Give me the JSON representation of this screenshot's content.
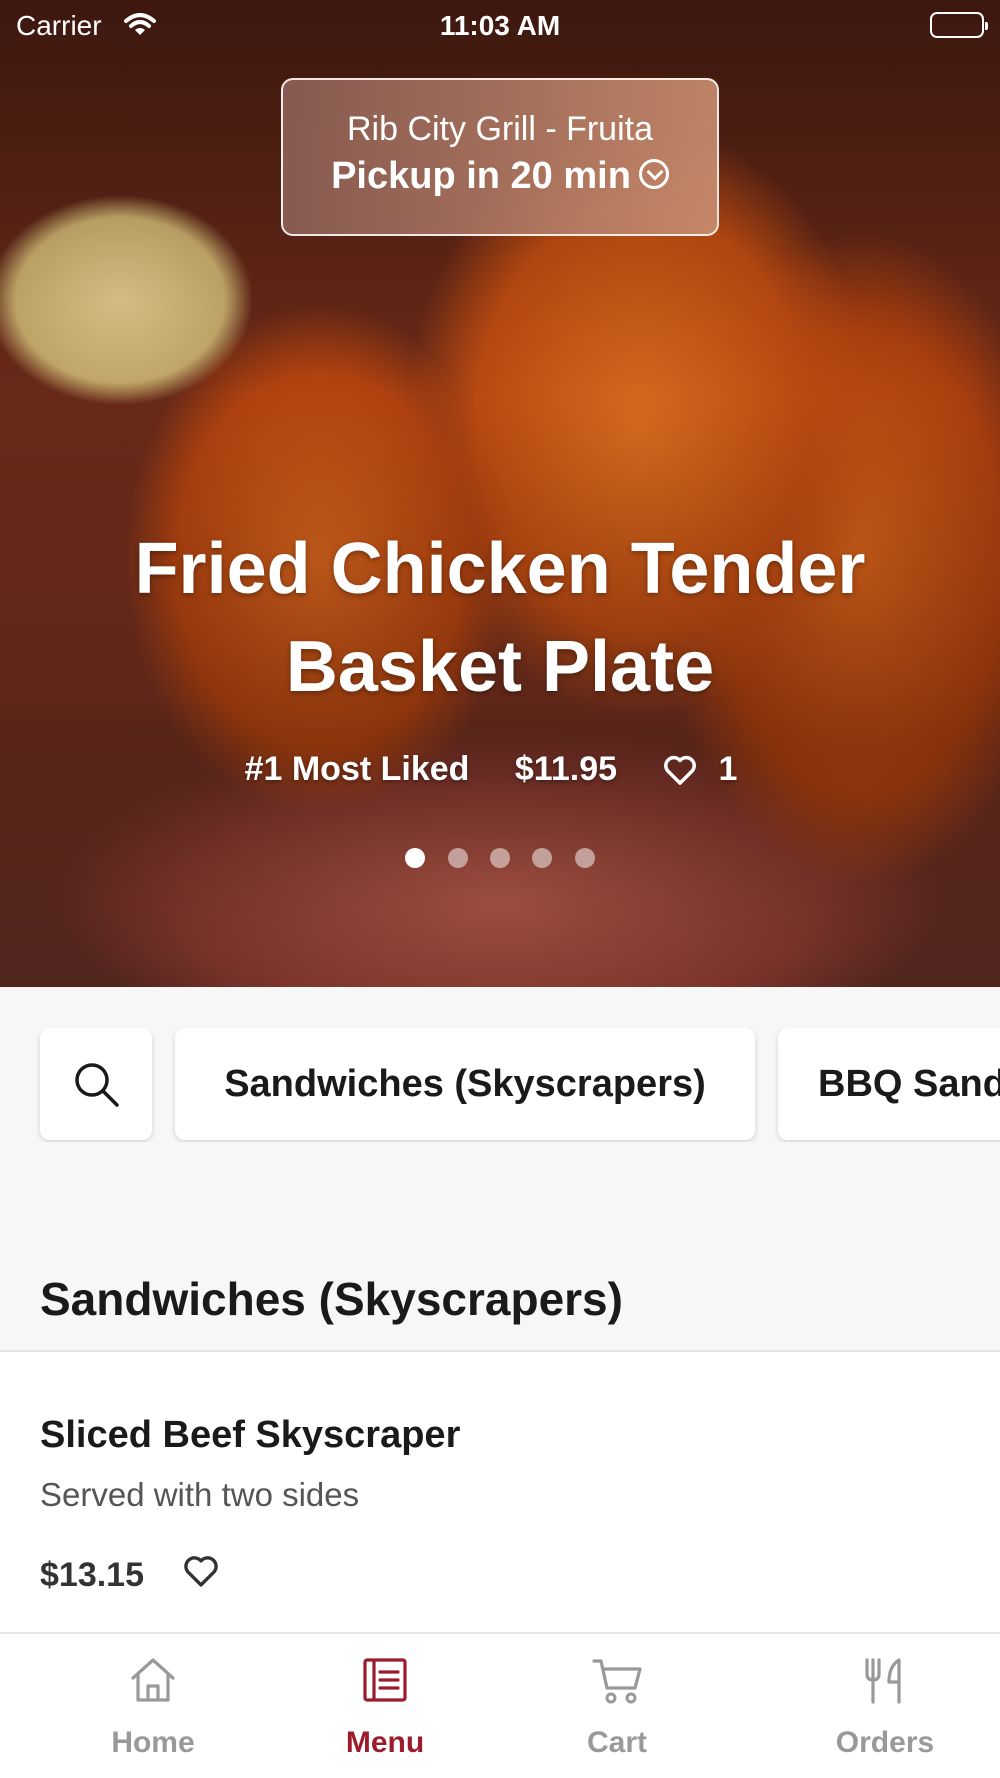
{
  "status_bar": {
    "carrier": "Carrier",
    "time": "11:03 AM"
  },
  "location": {
    "name": "Rib City Grill - Fruita",
    "pickup": "Pickup in 20 min"
  },
  "featured": {
    "title_line1": "Fried Chicken Tender",
    "title_line2": "Basket Plate",
    "rank": "#1 Most Liked",
    "price": "$11.95",
    "likes": "1",
    "carousel_total": 5,
    "carousel_active": 1
  },
  "categories": {
    "search_icon": "search-icon",
    "chips": [
      "Sandwiches (Skyscrapers)",
      "BBQ Sand"
    ]
  },
  "section": {
    "title": "Sandwiches (Skyscrapers)"
  },
  "menu_items": [
    {
      "name": "Sliced Beef Skyscraper",
      "description": "Served with two sides",
      "price": "$13.15"
    }
  ],
  "tab_bar": {
    "active": "Menu",
    "active_color": "#9b1c2c",
    "inactive_color": "#999999",
    "tabs": [
      {
        "label": "Home",
        "icon": "home-icon"
      },
      {
        "label": "Menu",
        "icon": "menu-icon"
      },
      {
        "label": "Cart",
        "icon": "cart-icon"
      },
      {
        "label": "Orders",
        "icon": "fork-knife-icon"
      }
    ]
  }
}
